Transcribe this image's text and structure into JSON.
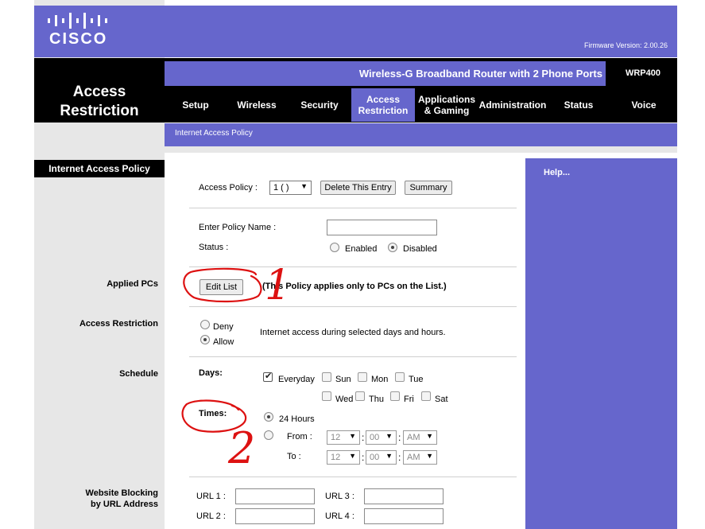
{
  "logo": {
    "text": "cisco"
  },
  "firmware": "Firmware Version: 2.00.26",
  "section_title": "Access Restriction",
  "product": {
    "name": "Wireless-G Broadband Router with 2 Phone Ports",
    "model": "WRP400"
  },
  "tabs": [
    {
      "label": "Setup"
    },
    {
      "label": "Wireless"
    },
    {
      "label": "Security"
    },
    {
      "label": "Access Restriction",
      "active": true
    },
    {
      "label": "Applications & Gaming"
    },
    {
      "label": "Administration"
    },
    {
      "label": "Status"
    },
    {
      "label": "Voice"
    }
  ],
  "subnav": {
    "label": "Internet Access Policy"
  },
  "left_heading": "Internet Access Policy",
  "help": {
    "label": "Help..."
  },
  "side_labels": {
    "applied_pcs": "Applied PCs",
    "access_restriction": "Access Restriction",
    "schedule": "Schedule",
    "website_blocking_line1": "Website Blocking",
    "website_blocking_line2": "by URL Address"
  },
  "policy": {
    "label": "Access Policy :",
    "selected": "1 ( )",
    "delete_button": "Delete This Entry",
    "summary_button": "Summary",
    "name_label": "Enter Policy Name :",
    "name_value": "",
    "status_label": "Status :",
    "enabled_label": "Enabled",
    "disabled_label": "Disabled",
    "status_value": "Disabled"
  },
  "applied_pcs": {
    "edit_button": "Edit List",
    "note": "(This Policy applies only to PCs on the List.)"
  },
  "restriction": {
    "deny_label": "Deny",
    "allow_label": "Allow",
    "selected": "Allow",
    "description": "Internet access during selected days and hours."
  },
  "schedule": {
    "days_label": "Days:",
    "days": [
      {
        "label": "Everyday",
        "checked": true
      },
      {
        "label": "Sun",
        "checked": false
      },
      {
        "label": "Mon",
        "checked": false
      },
      {
        "label": "Tue",
        "checked": false
      },
      {
        "label": "Wed",
        "checked": false
      },
      {
        "label": "Thu",
        "checked": false
      },
      {
        "label": "Fri",
        "checked": false
      },
      {
        "label": "Sat",
        "checked": false
      }
    ],
    "times_label": "Times:",
    "hours24_label": "24 Hours",
    "from_label": "From :",
    "to_label": "To :",
    "from": {
      "hour": "12",
      "minute": "00",
      "ampm": "AM"
    },
    "to": {
      "hour": "12",
      "minute": "00",
      "ampm": "AM"
    }
  },
  "url_blocking": {
    "url1_label": "URL 1 :",
    "url2_label": "URL 2 :",
    "url3_label": "URL 3 :",
    "url4_label": "URL 4 :"
  },
  "annotations": {
    "mark1": "1",
    "mark2": "2",
    "color": "#dd1111"
  },
  "colors": {
    "brand": "#6666cc",
    "band": "#000000",
    "sidebar": "#e7e7e7"
  }
}
